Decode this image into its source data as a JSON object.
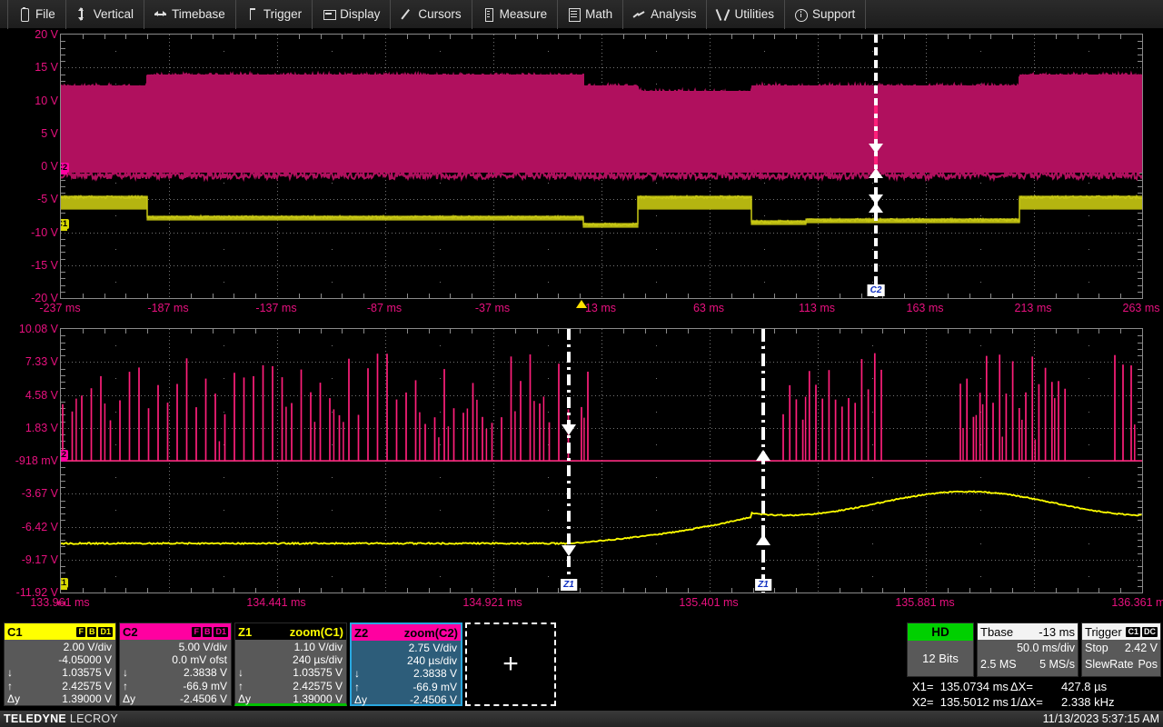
{
  "menu": {
    "items": [
      {
        "label": "File",
        "icon": "file-icon"
      },
      {
        "label": "Vertical",
        "icon": "vertical-arrows-icon"
      },
      {
        "label": "Timebase",
        "icon": "horizontal-arrows-icon"
      },
      {
        "label": "Trigger",
        "icon": "trigger-slope-icon"
      },
      {
        "label": "Display",
        "icon": "display-screen-icon"
      },
      {
        "label": "Cursors",
        "icon": "cursor-line-icon"
      },
      {
        "label": "Measure",
        "icon": "measure-list-icon"
      },
      {
        "label": "Math",
        "icon": "math-calculator-icon"
      },
      {
        "label": "Analysis",
        "icon": "analysis-trend-icon"
      },
      {
        "label": "Utilities",
        "icon": "utilities-wrench-icon"
      },
      {
        "label": "Support",
        "icon": "support-info-icon"
      }
    ]
  },
  "main_grid": {
    "y_labels": [
      "20 V",
      "15 V",
      "10 V",
      "5 V",
      "0 V",
      "-5 V",
      "-10 V",
      "-15 V",
      "-20 V"
    ],
    "x_labels": [
      "-237 ms",
      "-187 ms",
      "-137 ms",
      "-87 ms",
      "-37 ms",
      "13 ms",
      "63 ms",
      "113 ms",
      "163 ms",
      "213 ms",
      "263 ms"
    ],
    "ground_markers": [
      {
        "label": "C2",
        "color": "#e8117f"
      },
      {
        "label": "C1",
        "color": "#d8d800"
      }
    ],
    "cursor_label": "C2"
  },
  "zoom_grid": {
    "y_labels": [
      "10.08 V",
      "7.33 V",
      "4.58 V",
      "1.83 V",
      "-918 mV",
      "-3.67 V",
      "-6.42 V",
      "-9.17 V",
      "-11.92 V"
    ],
    "x_labels": [
      "133.961 ms",
      "134.441 ms",
      "134.921 ms",
      "135.401 ms",
      "135.881 ms",
      "136.361 ms"
    ],
    "ground_markers": [
      {
        "label": "Z2",
        "color": "#e8117f"
      },
      {
        "label": "Z1",
        "color": "#d8d800"
      }
    ],
    "cursor_labels": [
      "Z1",
      "Z1"
    ]
  },
  "descriptors": [
    {
      "name": "C1",
      "title": "C1",
      "subtitle": "",
      "badges": [
        "F",
        "B",
        "D1"
      ],
      "header_bg": "#ffff00",
      "header_fg": "#000000",
      "underline": "",
      "lines": [
        {
          "key": "",
          "value": "2.00 V/div"
        },
        {
          "key": "",
          "value": "-4.05000 V"
        },
        {
          "key": "↓",
          "value": "1.03575 V"
        },
        {
          "key": "↑",
          "value": "2.42575 V"
        },
        {
          "key": "Δy",
          "value": "1.39000 V"
        }
      ]
    },
    {
      "name": "C2",
      "title": "C2",
      "subtitle": "",
      "badges": [
        "F",
        "B",
        "D1"
      ],
      "header_bg": "#ff00a0",
      "header_fg": "#000000",
      "underline": "",
      "lines": [
        {
          "key": "",
          "value": "5.00 V/div"
        },
        {
          "key": "",
          "value": "0.0 mV ofst"
        },
        {
          "key": "↓",
          "value": "2.3838 V"
        },
        {
          "key": "↑",
          "value": "-66.9 mV"
        },
        {
          "key": "Δy",
          "value": "-2.4506 V"
        }
      ]
    },
    {
      "name": "Z1",
      "title": "Z1",
      "subtitle": "zoom(C1)",
      "badges": [],
      "header_bg": "#000000",
      "header_fg": "#ffff00",
      "underline": "#00c000",
      "lines": [
        {
          "key": "",
          "value": "1.10 V/div"
        },
        {
          "key": "",
          "value": "240 µs/div"
        },
        {
          "key": "↓",
          "value": "1.03575 V"
        },
        {
          "key": "↑",
          "value": "2.42575 V"
        },
        {
          "key": "Δy",
          "value": "1.39000 V"
        }
      ]
    },
    {
      "name": "Z2",
      "title": "Z2",
      "subtitle": "zoom(C2)",
      "badges": [],
      "header_bg": "#ff00a0",
      "header_fg": "#000000",
      "underline": "",
      "selected": true,
      "lines": [
        {
          "key": "",
          "value": "2.75 V/div"
        },
        {
          "key": "",
          "value": "240 µs/div"
        },
        {
          "key": "↓",
          "value": "2.3838 V"
        },
        {
          "key": "↑",
          "value": "-66.9 mV"
        },
        {
          "key": "Δy",
          "value": "-2.4506 V"
        }
      ]
    }
  ],
  "add_trace": {
    "label": "+"
  },
  "status": {
    "hd": {
      "title": "HD",
      "bits": "12 Bits"
    },
    "timebase": {
      "title": "Tbase",
      "delay": "-13 ms",
      "scale": "50.0 ms/div",
      "memory": "2.5 MS",
      "rate": "5 MS/s"
    },
    "trigger": {
      "title": "Trigger",
      "badges": [
        "C1",
        "DC"
      ],
      "state": "Stop",
      "level": "2.42 V",
      "type": "SlewRate",
      "slope": "Pos"
    },
    "cursor_readout": {
      "x1_label": "X1=",
      "x1_value": "135.0734 ms",
      "x2_label": "X2=",
      "x2_value": "135.5012 ms",
      "dx_label": "ΔX=",
      "dx_value": "427.8 µs",
      "inv_dx_label": "1/ΔX=",
      "inv_dx_value": "2.338 kHz"
    }
  },
  "bottom_bar": {
    "brand_bold": "TELEDYNE",
    "brand_light": "LECROY",
    "timestamp": "11/13/2023 5:37:15 AM"
  },
  "colors": {
    "c1_yellow": "#d8d800",
    "c2_magenta": "#b0105e",
    "z1_yellow": "#ffff00",
    "z2_pink": "#ff1f7a",
    "axis_label": "#e8117f",
    "grid": "#9a9a9a"
  }
}
